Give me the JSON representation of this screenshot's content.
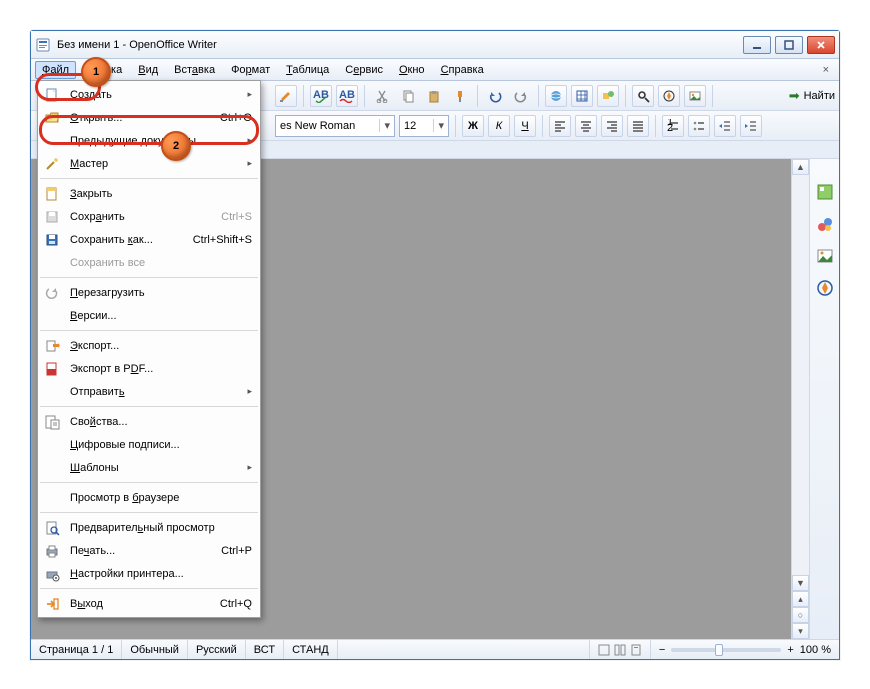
{
  "window": {
    "title": "Без имени 1 - OpenOffice Writer"
  },
  "menubar": {
    "items": [
      {
        "pre": "",
        "ul": "Ф",
        "post": "айл"
      },
      {
        "pre": "",
        "ul": "П",
        "post": "равка"
      },
      {
        "pre": "",
        "ul": "В",
        "post": "ид"
      },
      {
        "pre": "Вст",
        "ul": "а",
        "post": "вка"
      },
      {
        "pre": "Фо",
        "ul": "р",
        "post": "мат"
      },
      {
        "pre": "",
        "ul": "Т",
        "post": "аблица"
      },
      {
        "pre": "С",
        "ul": "е",
        "post": "рвис"
      },
      {
        "pre": "",
        "ul": "О",
        "post": "кно"
      },
      {
        "pre": "",
        "ul": "С",
        "post": "правка"
      }
    ]
  },
  "toolbar1": {
    "font_name": "es New Roman",
    "font_size": "12",
    "bold": "Ж",
    "italic": "К",
    "underline": "Ч",
    "find_label": "Найти"
  },
  "menu": {
    "create": {
      "ul": "С",
      "post": "оздать"
    },
    "open": {
      "ul": "О",
      "post": "ткрыть...",
      "sc": "Ctrl+O"
    },
    "recent": {
      "pre": "Преды",
      "ul": "д",
      "post": "ущие документы"
    },
    "wizard": {
      "ul": "М",
      "post": "астер"
    },
    "close": {
      "ul": "З",
      "post": "акрыть"
    },
    "save": {
      "pre": "Сохр",
      "ul": "а",
      "post": "нить",
      "sc": "Ctrl+S"
    },
    "saveas": {
      "pre": "Сохранить ",
      "ul": "к",
      "post": "ак...",
      "sc": "Ctrl+Shift+S"
    },
    "saveall": {
      "label": "Сохранить все"
    },
    "reload": {
      "ul": "П",
      "post": "ерезагрузить"
    },
    "versions": {
      "ul": "В",
      "post": "ерсии..."
    },
    "export": {
      "ul": "Э",
      "post": "кспорт..."
    },
    "exportpdf": {
      "pre": "Экспорт в P",
      "ul": "D",
      "post": "F..."
    },
    "send": {
      "pre": "Отправит",
      "ul": "ь",
      "post": ""
    },
    "properties": {
      "pre": "Сво",
      "ul": "й",
      "post": "ства..."
    },
    "digisig": {
      "ul": "Ц",
      "post": "ифровые подписи..."
    },
    "templates": {
      "ul": "Ш",
      "post": "аблоны"
    },
    "previewbrowser": {
      "pre": "Просмотр в ",
      "ul": "б",
      "post": "раузере"
    },
    "pagepreview": {
      "pre": "Предварител",
      "ul": "ь",
      "post": "ный просмотр"
    },
    "print": {
      "pre": "Пе",
      "ul": "ч",
      "post": "ать...",
      "sc": "Ctrl+P"
    },
    "printersetup": {
      "ul": "Н",
      "post": "астройки принтера..."
    },
    "exit": {
      "pre": "В",
      "ul": "ы",
      "post": "ход",
      "sc": "Ctrl+Q"
    }
  },
  "status": {
    "page": "Страница 1 / 1",
    "style": "Обычный",
    "lang": "Русский",
    "ins": "ВСТ",
    "std": "СТАНД",
    "zoom": "100 %"
  },
  "callouts": {
    "b1": "1",
    "b2": "2"
  }
}
